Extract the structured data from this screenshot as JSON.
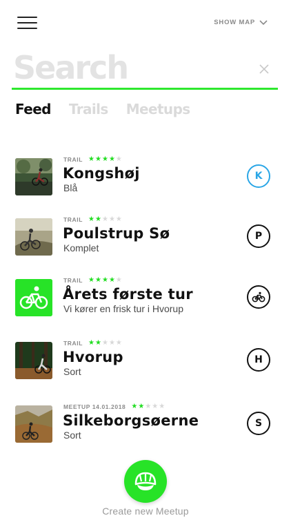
{
  "header": {
    "menu_icon": "hamburger-menu-icon",
    "show_map_label": "SHOW MAP",
    "show_map_icon": "chevron-down-icon"
  },
  "search": {
    "placeholder": "Search",
    "value": "",
    "clear_icon": "close-icon",
    "accent_color": "#2ee82e"
  },
  "tabs": [
    {
      "label": "Feed",
      "active": true
    },
    {
      "label": "Trails",
      "active": false
    },
    {
      "label": "Meetups",
      "active": false
    }
  ],
  "feed": [
    {
      "kind": "TRAIL",
      "rating": 4,
      "max_rating": 5,
      "title": "Kongshøj",
      "subtitle": "Blå",
      "badge": "K",
      "badge_color": "#2aa6e6",
      "thumb_icon": "trail-photo-thumbnail"
    },
    {
      "kind": "TRAIL",
      "rating": 2,
      "max_rating": 5,
      "title": "Poulstrup Sø",
      "subtitle": "Komplet",
      "badge": "P",
      "badge_color": "#111111",
      "thumb_icon": "trail-photo-thumbnail"
    },
    {
      "kind": "TRAIL",
      "rating": 4,
      "max_rating": 5,
      "title": "Årets første tur",
      "subtitle": "Vi kører en frisk tur i Hvorup",
      "badge": "bike-icon",
      "badge_color": "#111111",
      "thumb_icon": "bike-icon"
    },
    {
      "kind": "TRAIL",
      "rating": 2,
      "max_rating": 5,
      "title": "Hvorup",
      "subtitle": "Sort",
      "badge": "H",
      "badge_color": "#111111",
      "thumb_icon": "trail-photo-thumbnail"
    },
    {
      "kind": "MEETUP 14.01.2018",
      "rating": 2,
      "max_rating": 5,
      "title": "Silkeborgsøerne",
      "subtitle": "Sort",
      "badge": "S",
      "badge_color": "#111111",
      "thumb_icon": "trail-photo-thumbnail"
    }
  ],
  "fab": {
    "icon": "helmet-icon",
    "label": "Create new Meetup",
    "color": "#27e327"
  },
  "star_colors": {
    "on": "#22dd22",
    "off": "#d8d8d8"
  }
}
